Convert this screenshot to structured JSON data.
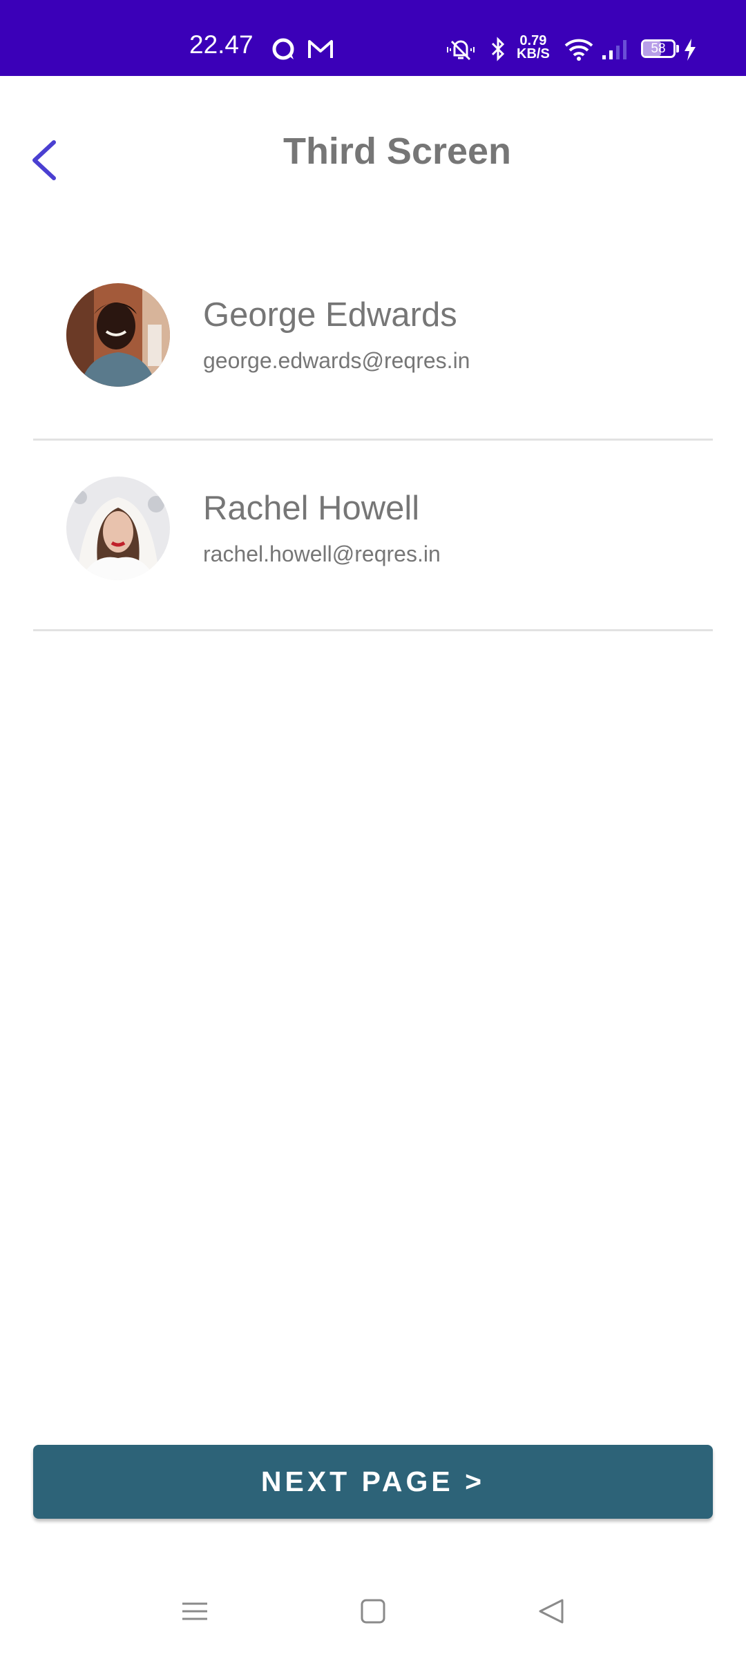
{
  "status_bar": {
    "time": "22.47",
    "speed_value": "0.79",
    "speed_unit": "KB/S",
    "battery": "58",
    "battery_level": 0.58,
    "background": "#3b00b8",
    "icons": [
      "chat-bubble-icon",
      "gmail-icon",
      "mute-icon",
      "bluetooth-icon",
      "wifi-icon",
      "signal-icon",
      "battery-icon",
      "charging-icon"
    ]
  },
  "app_bar": {
    "title": "Third Screen",
    "back_icon": "chevron-left-icon",
    "accent": "#4a3fd1"
  },
  "users": [
    {
      "name": "George Edwards",
      "email": "george.edwards@reqres.in",
      "avatar": "avatar-photo"
    },
    {
      "name": "Rachel Howell",
      "email": "rachel.howell@reqres.in",
      "avatar": "avatar-photo"
    }
  ],
  "next_button": {
    "label": "NEXT PAGE >",
    "color": "#2d6378"
  },
  "nav_bar": {
    "icons": [
      "menu-icon",
      "home-square-icon",
      "back-triangle-icon"
    ]
  }
}
